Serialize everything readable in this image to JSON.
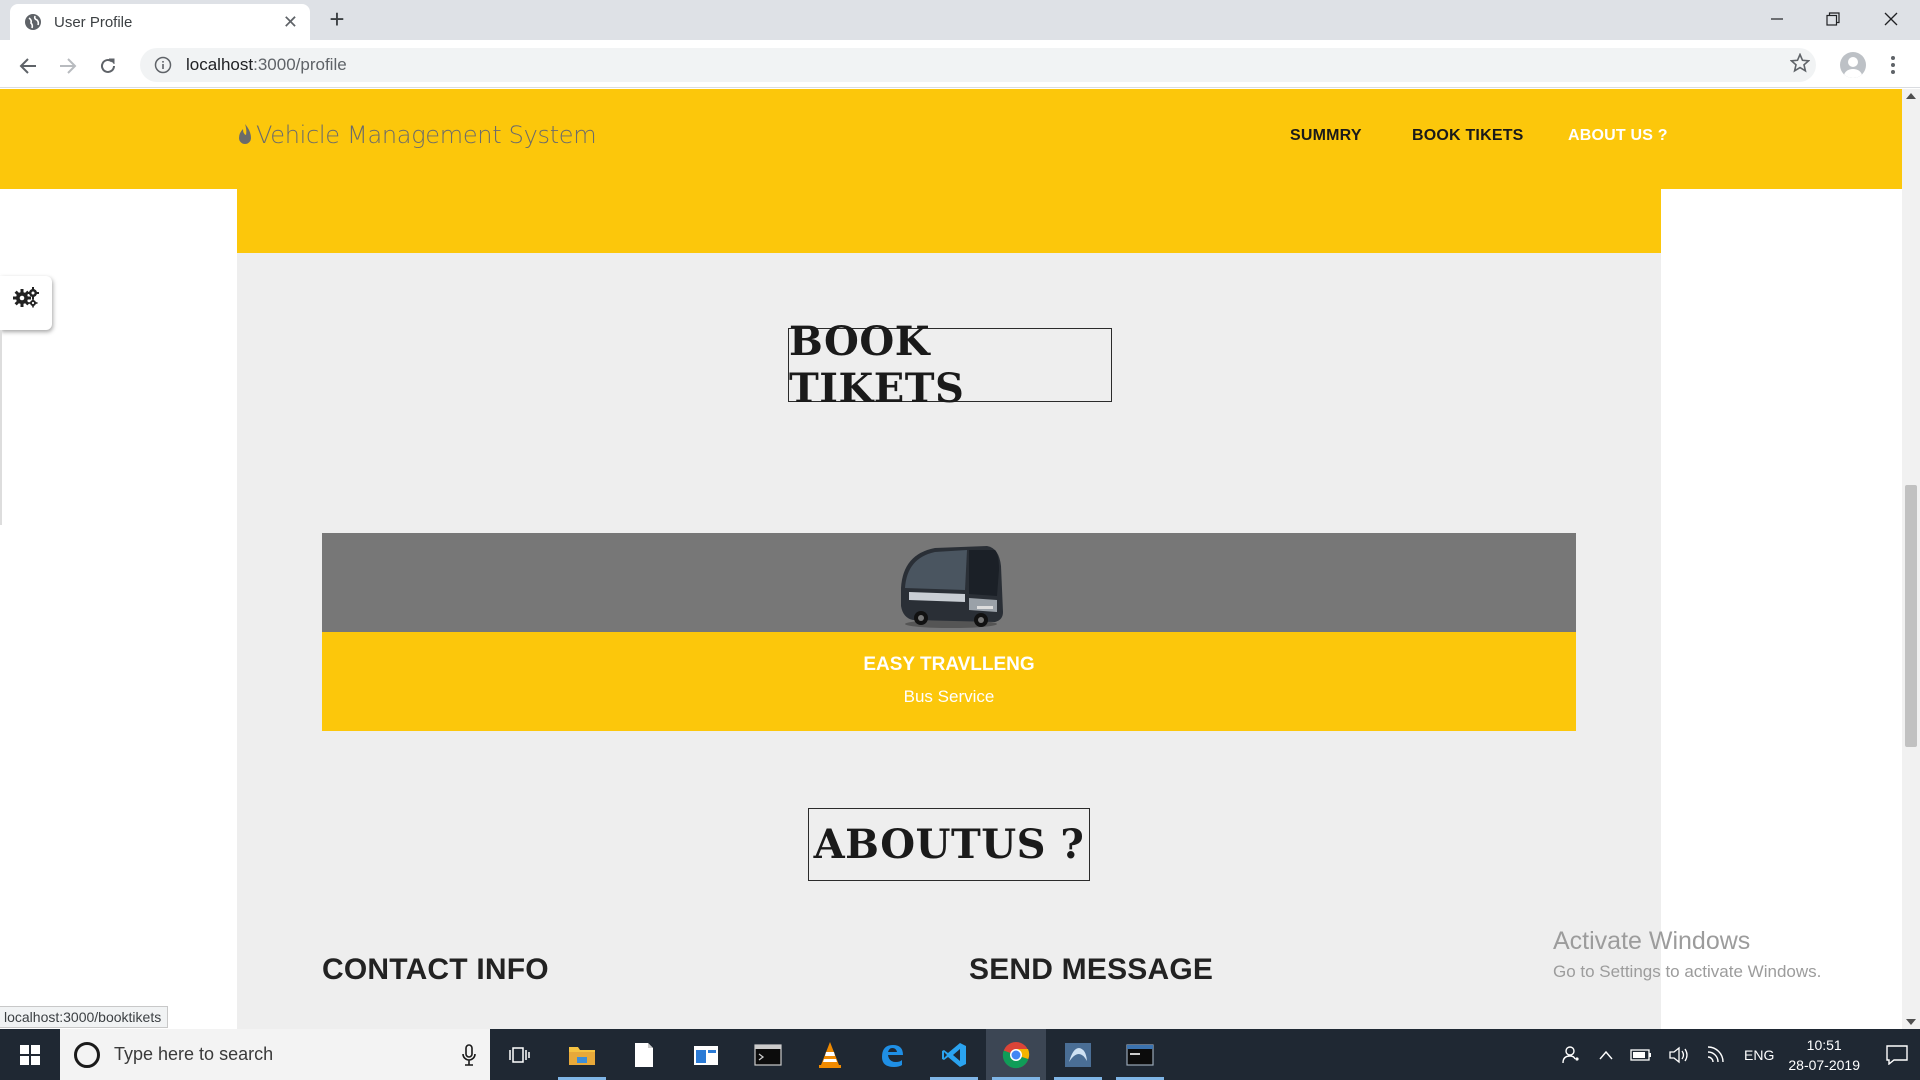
{
  "browser": {
    "tab_title": "User Profile",
    "url_host": "localhost",
    "url_path": ":3000/profile",
    "status_url": "localhost:3000/booktikets"
  },
  "site": {
    "brand": "Vehicle Management System",
    "nav": [
      {
        "label": "SUMMRY",
        "color": "#1a1a1a"
      },
      {
        "label": "BOOK TIKETS",
        "color": "#1a1a1a"
      },
      {
        "label": "ABOUT US ?",
        "color": "#ffffff"
      }
    ],
    "accent_color": "#fcc70b",
    "section_book": "BOOK TIKETS",
    "card": {
      "title": "EASY TRAVLLENG",
      "subtitle": "Bus Service",
      "image_icon": "bus-image"
    },
    "section_about": "ABOUTUS ?",
    "contact_title": "CONTACT INFO",
    "message_title": "SEND MESSAGE"
  },
  "watermark": {
    "line1": "Activate Windows",
    "line2": "Go to Settings to activate Windows."
  },
  "taskbar": {
    "search_placeholder": "Type here to search",
    "language": "ENG",
    "time": "10:51",
    "date": "28-07-2019"
  }
}
